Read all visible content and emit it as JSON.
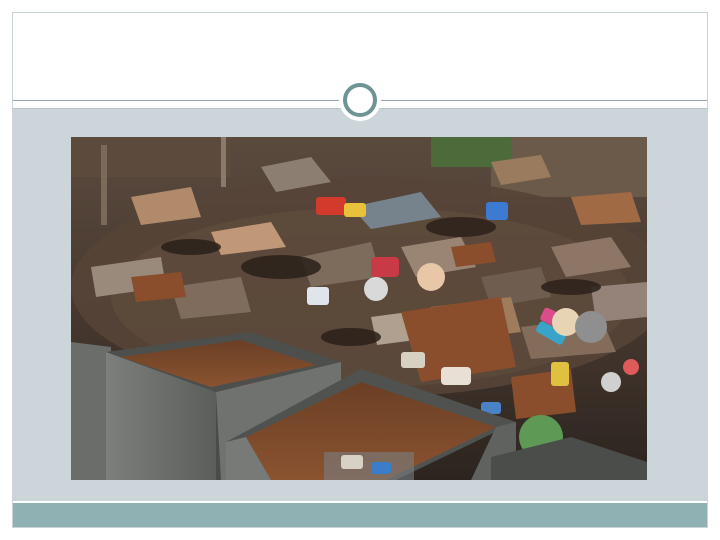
{
  "slide": {
    "title": "",
    "colors": {
      "frame_border": "#c9d3d6",
      "content_background": "#ccd6da",
      "footer_bar": "#8fb1b3",
      "ornament_ring": "#6f9495",
      "divider": "#8fa9ad"
    }
  },
  "image": {
    "subject": "scrap-metal-pile-photo"
  }
}
